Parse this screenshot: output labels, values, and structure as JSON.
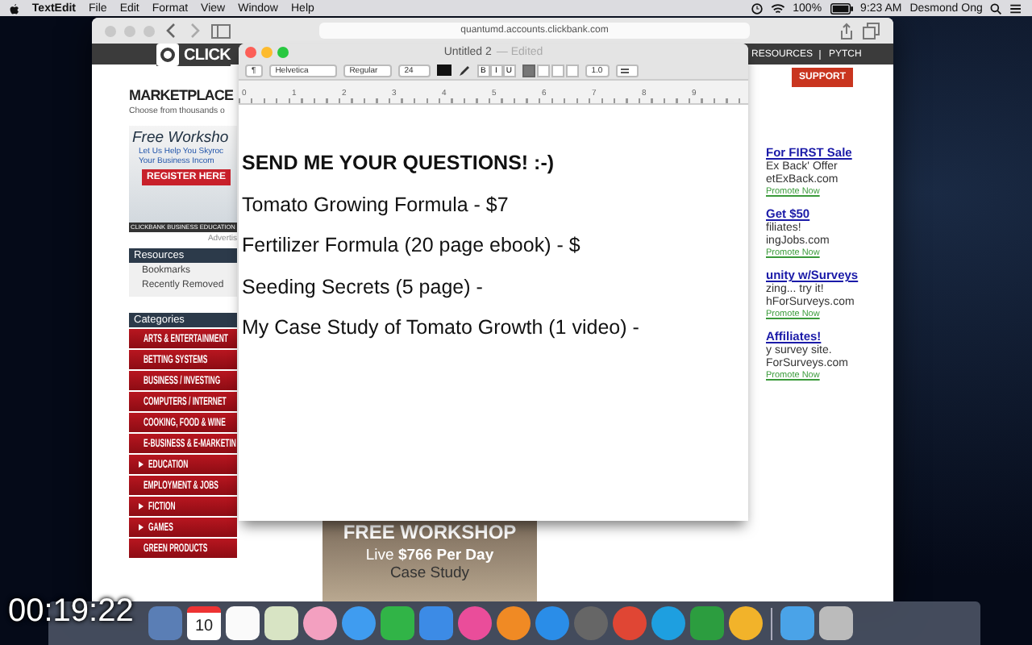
{
  "menubar": {
    "app": "TextEdit",
    "menus": [
      "File",
      "Edit",
      "Format",
      "View",
      "Window",
      "Help"
    ],
    "battery": "100%",
    "time": "9:23 AM",
    "user": "Desmond Ong"
  },
  "browser": {
    "url": "quantumd.accounts.clickbank.com",
    "logo": "CLICK",
    "nav": [
      "RESOURCES",
      "PYTCH"
    ],
    "heading": "MARKETPLACE",
    "subheading": "Choose from thousands o",
    "ad": {
      "title": "Free Worksho",
      "tagline": "Let Us Help You Skyroc",
      "tagline_2": "Your Business Incom",
      "button": "REGISTER HERE",
      "footer": "CLICKBANK BUSINESS EDUCATION",
      "label": "Advertis"
    },
    "resources": {
      "title": "Resources",
      "items": [
        "Bookmarks",
        "Recently Removed"
      ]
    },
    "categories": {
      "title": "Categories",
      "items": [
        "ARTS & ENTERTAINMENT",
        "BETTING SYSTEMS",
        "BUSINESS / INVESTING",
        "COMPUTERS / INTERNET",
        "COOKING, FOOD & WINE",
        "E-BUSINESS & E-MARKETIN",
        "EDUCATION",
        "EMPLOYMENT & JOBS",
        "FICTION",
        "GAMES",
        "GREEN PRODUCTS"
      ]
    },
    "support_button": "SUPPORT",
    "promos": [
      {
        "title": "For FIRST Sale",
        "line_1": "Ex Back' Offer",
        "line_2": "etExBack.com",
        "link": "Promote Now"
      },
      {
        "title": "Get $50",
        "line_1": "filiates!",
        "line_2": "ingJobs.com",
        "link": "Promote Now"
      },
      {
        "title": "unity w/Surveys",
        "line_1": "zing... try it!",
        "line_2": "hForSurveys.com",
        "link": "Promote Now"
      },
      {
        "title": "Affiliates!",
        "line_1": "y survey site.",
        "line_2": "ForSurveys.com",
        "link": "Promote Now"
      }
    ],
    "banner": {
      "title": "FREE WORKSHOP",
      "line_1": "Live **$766 Per Day**",
      "line_2": "Case Study"
    }
  },
  "textedit": {
    "paragraph_menu": "¶",
    "title": "Untitled 2",
    "status": "— Edited",
    "font": "Helvetica",
    "style": "Regular",
    "size": "24",
    "format_buttons": [
      "B",
      "I",
      "U"
    ],
    "alignment": [
      {
        "selected": true
      },
      {
        "selected": false
      },
      {
        "selected": false
      },
      {
        "selected": false
      }
    ],
    "line_spacing": "1.0",
    "ruler_numbers": [
      "0",
      "1",
      "2",
      "3",
      "4",
      "5",
      "6",
      "7",
      "8",
      "9"
    ],
    "lines": [
      {
        "text": "SEND ME YOUR QUESTIONS! :-)",
        "bold": true
      },
      {
        "text": "Tomato Growing Formula - $7",
        "bold": false
      },
      {
        "text": "Fertilizer Formula (20 page ebook) - $",
        "bold": false
      },
      {
        "text": "Seeding Secrets (5 page) -",
        "bold": false
      },
      {
        "text": "My Case Study of Tomato Growth (1 video) -",
        "bold": false
      }
    ]
  },
  "dock": {
    "calendar_day": "10"
  },
  "video_timestamp": "00:19:22"
}
